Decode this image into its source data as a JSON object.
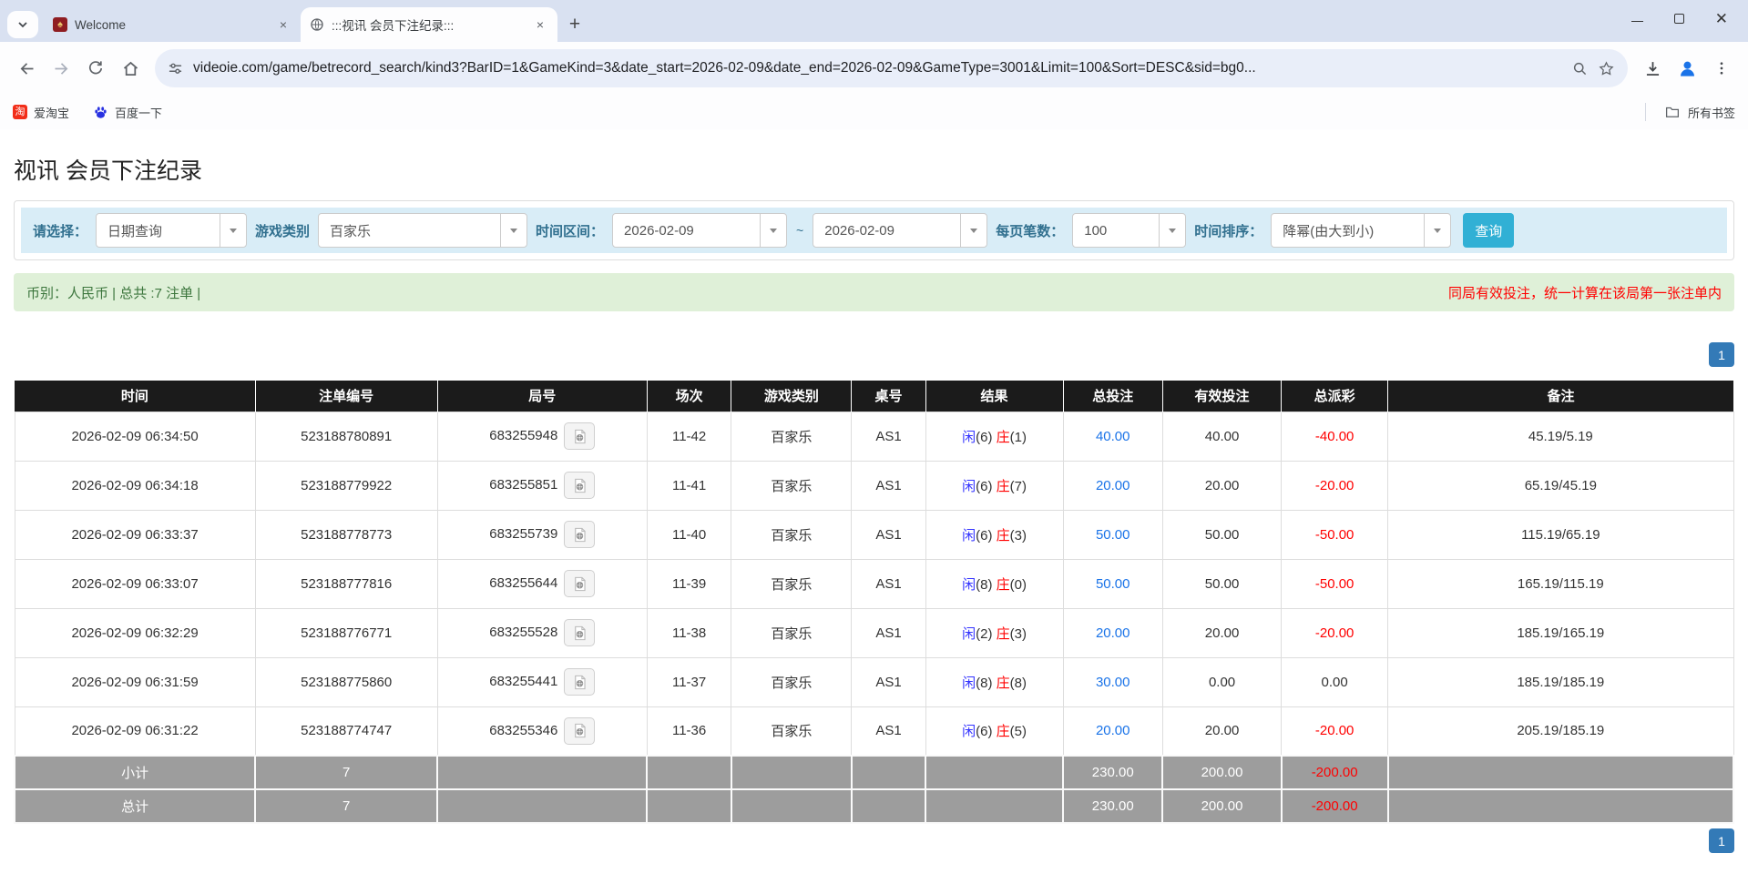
{
  "window": {
    "tabs": [
      {
        "title": "Welcome"
      },
      {
        "title": ":::视讯 会员下注纪录:::"
      }
    ],
    "icons": {
      "welcome_favicon_glyph": "♠",
      "taobao_glyph": "淘",
      "new_tab_glyph": "+",
      "close_glyph": "×"
    }
  },
  "toolbar": {
    "url": "videoie.com/game/betrecord_search/kind3?BarID=1&GameKind=3&date_start=2026-02-09&date_end=2026-02-09&GameType=3001&Limit=100&Sort=DESC&sid=bg0..."
  },
  "bookmarks": {
    "items": [
      {
        "label": "爱淘宝"
      },
      {
        "label": "百度一下"
      }
    ],
    "all_bookmarks": "所有书签"
  },
  "page": {
    "title": "视讯 会员下注纪录",
    "filters": {
      "select_label": "请选择：",
      "select_value": "日期查询",
      "game_label": "游戏类别",
      "game_value": "百家乐",
      "range_label": "时间区间：",
      "date_start": "2026-02-09",
      "range_separator": "~",
      "date_end": "2026-02-09",
      "per_page_label": "每页笔数：",
      "per_page_value": "100",
      "sort_label": "时间排序：",
      "sort_value": "降幂(由大到小)",
      "search_button": "查询"
    },
    "summary_left": "币别：人民币 | 总共 :7 注单 |",
    "summary_right": "同局有效投注，统一计算在该局第一张注单内",
    "pagination_top": "1",
    "pagination_bottom": "1",
    "table": {
      "headers": [
        "时间",
        "注单编号",
        "局号",
        "场次",
        "游戏类别",
        "桌号",
        "结果",
        "总投注",
        "有效投注",
        "总派彩",
        "备注"
      ],
      "result_labels": {
        "player": "闲",
        "banker": "庄"
      },
      "rows": [
        {
          "time": "2026-02-09 06:34:50",
          "bet_id": "523188780891",
          "round_id": "683255948",
          "session": "11-42",
          "game": "百家乐",
          "table_no": "AS1",
          "player": "6",
          "banker": "1",
          "total_bet": "40.00",
          "valid_bet": "40.00",
          "payout": "-40.00",
          "remark": "45.19/5.19"
        },
        {
          "time": "2026-02-09 06:34:18",
          "bet_id": "523188779922",
          "round_id": "683255851",
          "session": "11-41",
          "game": "百家乐",
          "table_no": "AS1",
          "player": "6",
          "banker": "7",
          "total_bet": "20.00",
          "valid_bet": "20.00",
          "payout": "-20.00",
          "remark": "65.19/45.19"
        },
        {
          "time": "2026-02-09 06:33:37",
          "bet_id": "523188778773",
          "round_id": "683255739",
          "session": "11-40",
          "game": "百家乐",
          "table_no": "AS1",
          "player": "6",
          "banker": "3",
          "total_bet": "50.00",
          "valid_bet": "50.00",
          "payout": "-50.00",
          "remark": "115.19/65.19"
        },
        {
          "time": "2026-02-09 06:33:07",
          "bet_id": "523188777816",
          "round_id": "683255644",
          "session": "11-39",
          "game": "百家乐",
          "table_no": "AS1",
          "player": "8",
          "banker": "0",
          "total_bet": "50.00",
          "valid_bet": "50.00",
          "payout": "-50.00",
          "remark": "165.19/115.19"
        },
        {
          "time": "2026-02-09 06:32:29",
          "bet_id": "523188776771",
          "round_id": "683255528",
          "session": "11-38",
          "game": "百家乐",
          "table_no": "AS1",
          "player": "2",
          "banker": "3",
          "total_bet": "20.00",
          "valid_bet": "20.00",
          "payout": "-20.00",
          "remark": "185.19/165.19"
        },
        {
          "time": "2026-02-09 06:31:59",
          "bet_id": "523188775860",
          "round_id": "683255441",
          "session": "11-37",
          "game": "百家乐",
          "table_no": "AS1",
          "player": "8",
          "banker": "8",
          "total_bet": "30.00",
          "valid_bet": "0.00",
          "payout": "0.00",
          "remark": "185.19/185.19"
        },
        {
          "time": "2026-02-09 06:31:22",
          "bet_id": "523188774747",
          "round_id": "683255346",
          "session": "11-36",
          "game": "百家乐",
          "table_no": "AS1",
          "player": "6",
          "banker": "5",
          "total_bet": "20.00",
          "valid_bet": "20.00",
          "payout": "-20.00",
          "remark": "205.19/185.19"
        }
      ],
      "footer_rows": [
        {
          "label": "小计",
          "count": "7",
          "total_bet": "230.00",
          "valid_bet": "200.00",
          "payout": "-200.00"
        },
        {
          "label": "总计",
          "count": "7",
          "total_bet": "230.00",
          "valid_bet": "200.00",
          "payout": "-200.00"
        }
      ]
    }
  },
  "colors": {
    "accent_teal": "#31b0d5",
    "pagination_blue": "#337ab7",
    "link_blue": "#1a73e8",
    "player_blue": "#3333ff",
    "banker_red": "#ff0000",
    "negative_red": "#ff0000",
    "filter_bar_bg": "#d9edf7",
    "summary_bg": "#dff0d8",
    "summary_text_green": "#3c763d",
    "table_header_bg": "#1b1b1b",
    "table_footer_bg": "#9d9d9d"
  }
}
